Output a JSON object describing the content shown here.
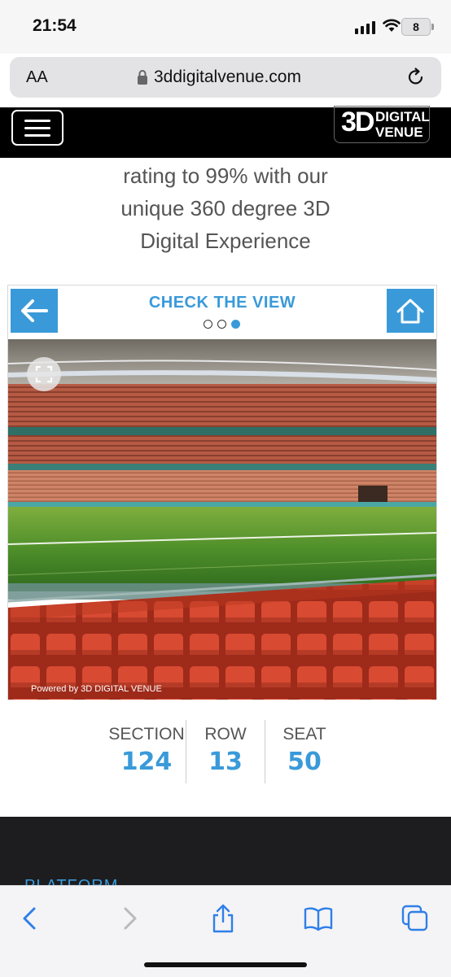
{
  "status_bar": {
    "time": "21:54",
    "battery": "8"
  },
  "url_bar": {
    "aa_label": "AA",
    "domain": "3ddigitalvenue.com"
  },
  "site_header": {
    "logo_big": "3D",
    "logo_line1": "DIGITAL",
    "logo_line2": "VENUE"
  },
  "intro": {
    "line1": "rating to 99% with our",
    "line2": "unique 360 degree 3D",
    "line3": "Digital Experience"
  },
  "viewer": {
    "title": "CHECK THE VIEW",
    "dots_active_index": 2,
    "powered_by": "Powered by 3D DIGITAL VENUE"
  },
  "seat": {
    "section_label": "SECTION",
    "section_value": "124",
    "row_label": "ROW",
    "row_value": "13",
    "seat_label": "SEAT",
    "seat_value": "50"
  },
  "footer": {
    "platform_label": "PLATFORM"
  },
  "colors": {
    "accent": "#3a9ad9",
    "header_bg": "#000000",
    "footer_bg": "#1d1d1f"
  }
}
